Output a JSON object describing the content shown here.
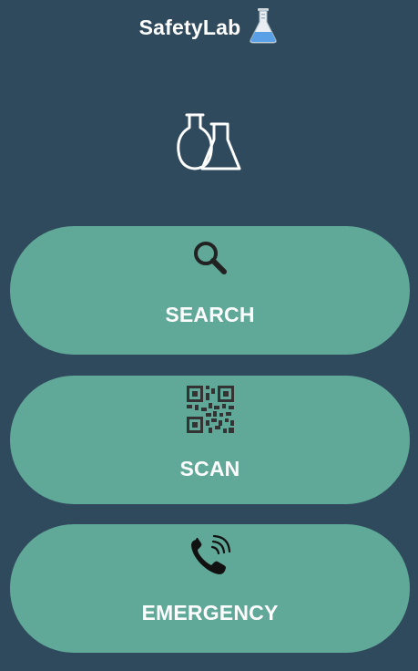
{
  "header": {
    "title": "SafetyLab",
    "title_icon": "flask-icon"
  },
  "hero": {
    "icon": "lab-glassware-icon"
  },
  "actions": [
    {
      "label": "SEARCH",
      "icon": "search-icon"
    },
    {
      "label": "SCAN",
      "icon": "qr-code-icon"
    },
    {
      "label": "EMERGENCY",
      "icon": "phone-call-icon"
    }
  ],
  "colors": {
    "background": "#2f4a5c",
    "button": "#60a898",
    "text": "#ffffff",
    "icon_dark": "#222222",
    "flask_blue": "#5aa0e6"
  }
}
